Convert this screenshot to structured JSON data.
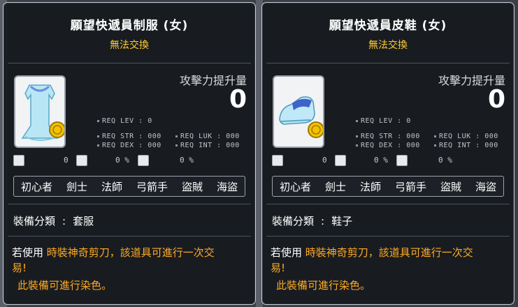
{
  "tooltips": [
    {
      "title": "願望快遞員制服 (女)",
      "untradeable": "無法交換",
      "attack_increase_label": "攻擊力提升量",
      "attack_increase_value": "0",
      "req_lev": "REQ LEV :    0",
      "req_str": "REQ STR : 000",
      "req_luk": "REQ LUK : 000",
      "req_dex": "REQ DEX : 000",
      "req_int": "REQ INT : 000",
      "stat_1": "0",
      "stat_2": "0 %",
      "stat_3": "0 %",
      "jobs": [
        "初心者",
        "劍士",
        "法師",
        "弓箭手",
        "盜賊",
        "海盜"
      ],
      "category_label": "裝備分類",
      "category_sep": ":",
      "category_value": "套服",
      "scissors_prefix": "若使用",
      "scissors_text_1": "時裝神奇剪刀，該道具可進行一次交",
      "scissors_text_2": "易!",
      "dye_text": "此裝備可進行染色。",
      "item_icon": "dress-icon"
    },
    {
      "title": "願望快遞員皮鞋 (女)",
      "untradeable": "無法交換",
      "attack_increase_label": "攻擊力提升量",
      "attack_increase_value": "0",
      "req_lev": "REQ LEV :    0",
      "req_str": "REQ STR : 000",
      "req_luk": "REQ LUK : 000",
      "req_dex": "REQ DEX : 000",
      "req_int": "REQ INT : 000",
      "stat_1": "0",
      "stat_2": "0 %",
      "stat_3": "0 %",
      "jobs": [
        "初心者",
        "劍士",
        "法師",
        "弓箭手",
        "盜賊",
        "海盜"
      ],
      "category_label": "裝備分類",
      "category_sep": ":",
      "category_value": "鞋子",
      "scissors_prefix": "若使用",
      "scissors_text_1": "時裝神奇剪刀，該道具可進行一次交",
      "scissors_text_2": "易!",
      "dye_text": "此裝備可進行染色。",
      "item_icon": "shoe-icon"
    }
  ],
  "colors": {
    "title": "#ffffff",
    "untradeable": "#ffcc33",
    "highlight": "#ffaa22",
    "panel_bg": "#161a20",
    "border": "#c9ccd2"
  }
}
